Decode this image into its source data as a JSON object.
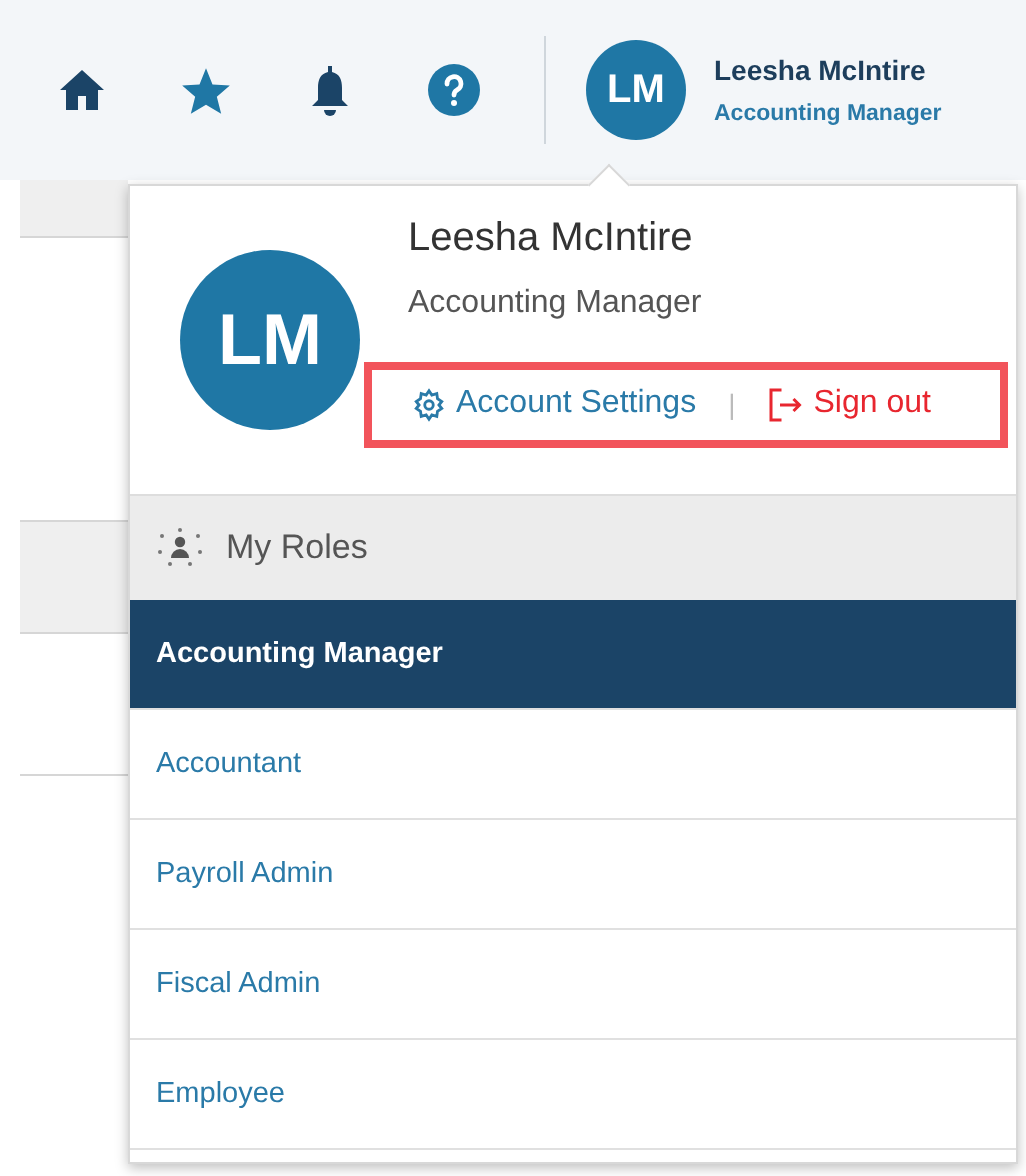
{
  "header": {
    "icons": [
      {
        "kind": "home"
      },
      {
        "kind": "favorites"
      },
      {
        "kind": "notifications"
      },
      {
        "kind": "help"
      }
    ],
    "user": {
      "initials": "LM",
      "name": "Leesha McIntire",
      "role": "Accounting Manager"
    }
  },
  "profile": {
    "initials": "LM",
    "name": "Leesha McIntire",
    "role": "Accounting Manager",
    "links_highlighted": true,
    "account_settings": "Account Settings",
    "separator": "|",
    "sign_out": "Sign out"
  },
  "roles": {
    "heading": "My Roles",
    "items": [
      {
        "label": "Accounting Manager",
        "selected": true
      },
      {
        "label": "Accountant",
        "selected": false
      },
      {
        "label": "Payroll Admin",
        "selected": false
      },
      {
        "label": "Fiscal Admin",
        "selected": false
      },
      {
        "label": "Employee",
        "selected": false
      }
    ]
  }
}
